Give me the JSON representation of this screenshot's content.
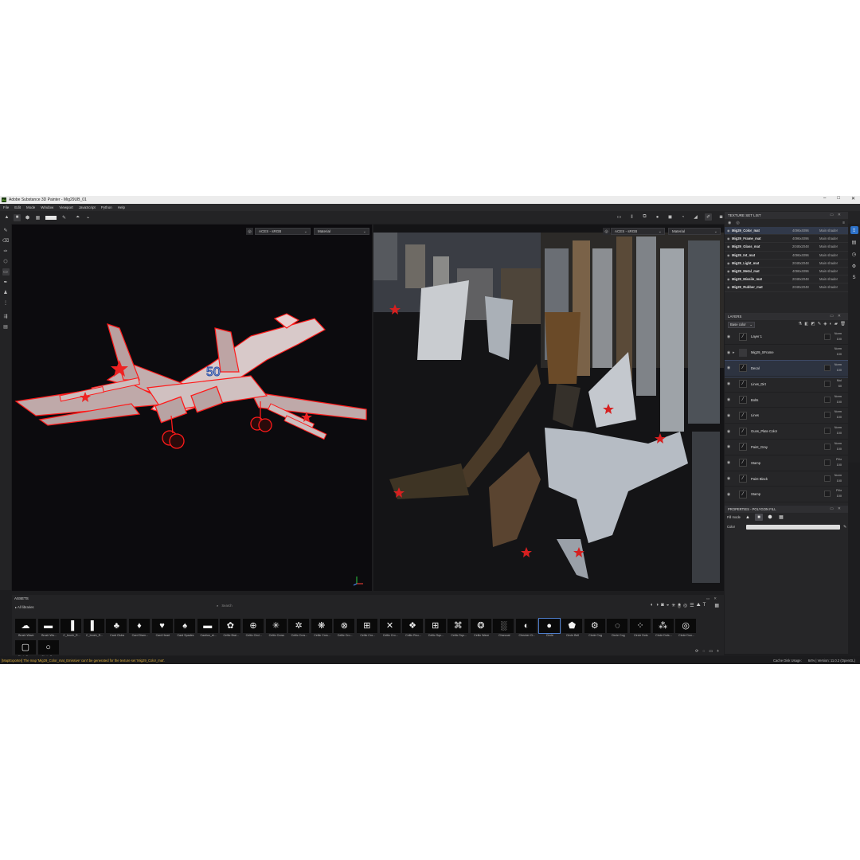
{
  "window": {
    "title": "Adobe Substance 3D Painter - Mig29UB_01",
    "logo": "Pt",
    "controls": [
      "–",
      "□",
      "✕"
    ]
  },
  "menu": [
    "File",
    "Edit",
    "Mode",
    "Window",
    "Viewport",
    "JavaScript",
    "Python",
    "Help"
  ],
  "viewport3d": {
    "colorspace": "ACES - sRGB",
    "channel": "Material"
  },
  "viewport2d": {
    "colorspace": "ACES - sRGB",
    "channel": "Material"
  },
  "texture_set_list": {
    "title": "TEXTURE SET LIST",
    "items": [
      {
        "name": "Mig29_Color_mat",
        "res": "4096x4096",
        "shader": "Main shader"
      },
      {
        "name": "Mig29_Frame_mat",
        "res": "4096x4096",
        "shader": "Main shader"
      },
      {
        "name": "Mig29_Glass_mat",
        "res": "2048x2048",
        "shader": "Main shader"
      },
      {
        "name": "Mig29_Int_mat",
        "res": "4096x4096",
        "shader": "Main shader"
      },
      {
        "name": "Mig29_Light_mat",
        "res": "2048x2048",
        "shader": "Main shader"
      },
      {
        "name": "Mig29_Metal_mat",
        "res": "4096x4096",
        "shader": "Main shader"
      },
      {
        "name": "Mig29_Missile_mat",
        "res": "2048x2048",
        "shader": "Main shader"
      },
      {
        "name": "Mig29_Rubber_mat",
        "res": "2048x2048",
        "shader": "Main shader"
      }
    ]
  },
  "layers": {
    "title": "LAYERS",
    "channel": "Base color",
    "items": [
      {
        "name": "Layer 1",
        "blend": "Norm",
        "opacity": "100"
      },
      {
        "name": "Mig29_SFrame",
        "blend": "Norm",
        "opacity": "100"
      },
      {
        "name": "Decal",
        "blend": "Norm",
        "opacity": "100"
      },
      {
        "name": "Lines_Dirt",
        "blend": "Mul",
        "opacity": "60"
      },
      {
        "name": "Bolts",
        "blend": "Norm",
        "opacity": "100"
      },
      {
        "name": "Lines",
        "blend": "Norm",
        "opacity": "100"
      },
      {
        "name": "Guns_Plate Color",
        "blend": "Norm",
        "opacity": "100"
      },
      {
        "name": "Paint_Gray",
        "blend": "Norm",
        "opacity": "100"
      },
      {
        "name": "Stamp",
        "blend": "Pthr",
        "opacity": "100"
      },
      {
        "name": "Paint Black",
        "blend": "Norm",
        "opacity": "100"
      },
      {
        "name": "Stamp",
        "blend": "Pthr",
        "opacity": "100"
      }
    ]
  },
  "properties": {
    "title": "PROPERTIES - POLYGON FILL",
    "fill_mode_label": "Fill mode",
    "color_label": "Color"
  },
  "assets": {
    "title": "ASSETS",
    "library": "All libraries",
    "search_placeholder": "Search",
    "items": [
      {
        "label": "Brush Wave",
        "glyph": "☁"
      },
      {
        "label": "Brush Wa...",
        "glyph": "▬"
      },
      {
        "label": "C_brush_R...",
        "glyph": "▐"
      },
      {
        "label": "C_brush_R...",
        "glyph": "▌"
      },
      {
        "label": "Card Clubs",
        "glyph": "♣"
      },
      {
        "label": "Card Diam...",
        "glyph": "♦"
      },
      {
        "label": "Card Heart",
        "glyph": "♥"
      },
      {
        "label": "Card Spades",
        "glyph": "♠"
      },
      {
        "label": "Caution_st...",
        "glyph": "▬"
      },
      {
        "label": "Celtic Brai...",
        "glyph": "✿"
      },
      {
        "label": "Celtic Circl...",
        "glyph": "⊕"
      },
      {
        "label": "Celtic Cross",
        "glyph": "✳"
      },
      {
        "label": "Celtic Cros...",
        "glyph": "✲"
      },
      {
        "label": "Celtic Cros...",
        "glyph": "❋"
      },
      {
        "label": "Celtic Cro...",
        "glyph": "⊗"
      },
      {
        "label": "Celtic Cro...",
        "glyph": "⊞"
      },
      {
        "label": "Celtic Cro...",
        "glyph": "✕"
      },
      {
        "label": "Celtic Rou...",
        "glyph": "❖"
      },
      {
        "label": "Celtic Squ...",
        "glyph": "⊞"
      },
      {
        "label": "Celtic Squ...",
        "glyph": "⌘"
      },
      {
        "label": "Celtic Wave",
        "glyph": "❂"
      },
      {
        "label": "Charcoal",
        "glyph": "░"
      },
      {
        "label": "Checker Ci...",
        "glyph": "◐"
      },
      {
        "label": "Circle",
        "glyph": "●"
      },
      {
        "label": "Circle Bell",
        "glyph": "⬟"
      },
      {
        "label": "Circle Cog",
        "glyph": "⚙"
      },
      {
        "label": "Circle Cog",
        "glyph": "◌"
      },
      {
        "label": "Circle Dots",
        "glyph": "⁘"
      },
      {
        "label": "Circle Dots...",
        "glyph": "⁂"
      },
      {
        "label": "Circle Dou...",
        "glyph": "◎"
      },
      {
        "label": "Circle Emp...",
        "glyph": "▢"
      },
      {
        "label": "Circle Gear",
        "glyph": "○"
      }
    ]
  },
  "status": {
    "message": "[MapExporter] The map 'Mig29_Color_mat_Emissive' can't be generated for the texture set 'Mig29_Color_mat'.",
    "cache": "Cache Disk Usage:",
    "version": "64% | Version: 11.0.2 (OpenGL)"
  },
  "colors": {
    "app_bg": "#1d1d1f",
    "accent": "#2e72c9",
    "warning": "#e0b03c",
    "highlight_red": "#ff1a1a"
  }
}
